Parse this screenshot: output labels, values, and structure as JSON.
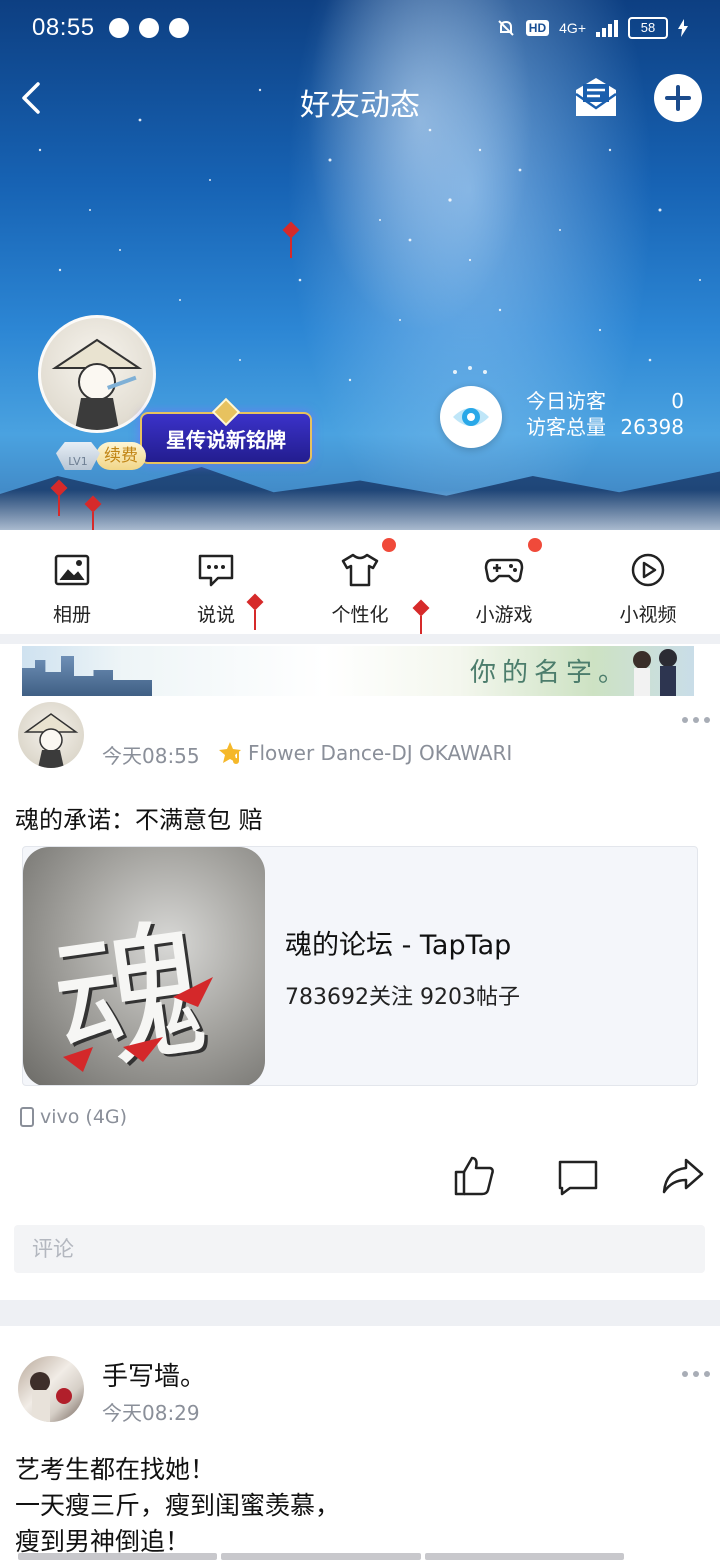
{
  "status_bar": {
    "time": "08:55",
    "network": "4G+",
    "hd": "HD",
    "battery": "58"
  },
  "header": {
    "title": "好友动态"
  },
  "profile": {
    "medal_label": "星传说新铭牌",
    "level": "LV1",
    "renew_label": "续费",
    "today_visitors_label": "今日访客",
    "today_visitors_value": "0",
    "total_visitors_label": "访客总量",
    "total_visitors_value": "26398"
  },
  "nav": {
    "items": [
      {
        "label": "相册",
        "icon": "photo-album-icon",
        "badge": false
      },
      {
        "label": "说说",
        "icon": "chat-bubble-icon",
        "badge": false
      },
      {
        "label": "个性化",
        "icon": "tshirt-icon",
        "badge": true
      },
      {
        "label": "小游戏",
        "icon": "gamepad-icon",
        "badge": true
      },
      {
        "label": "小视频",
        "icon": "play-video-icon",
        "badge": false
      }
    ]
  },
  "banner": {
    "text": "你的名字。"
  },
  "post1": {
    "time": "今天08:55",
    "music": "Flower Dance-DJ OKAWARI",
    "text": "魂的承诺：不满意包 赔",
    "share": {
      "image_text": "魂",
      "title": "魂的论坛 - TapTap",
      "subtitle": "783692关注 9203帖子"
    },
    "device": "vivo (4G)",
    "comment_placeholder": "评论"
  },
  "post2": {
    "name": "手写墙。",
    "time": "今天08:29",
    "lines": [
      "艺考生都在找她！",
      "一天瘦三斤，瘦到闺蜜羡慕，",
      "瘦到男神倒追！"
    ]
  },
  "colors": {
    "accent_red": "#f04a3a",
    "medal_blue": "#2a23a8",
    "muted_text": "#8a8f99",
    "eye_blue": "#29a8e8"
  }
}
